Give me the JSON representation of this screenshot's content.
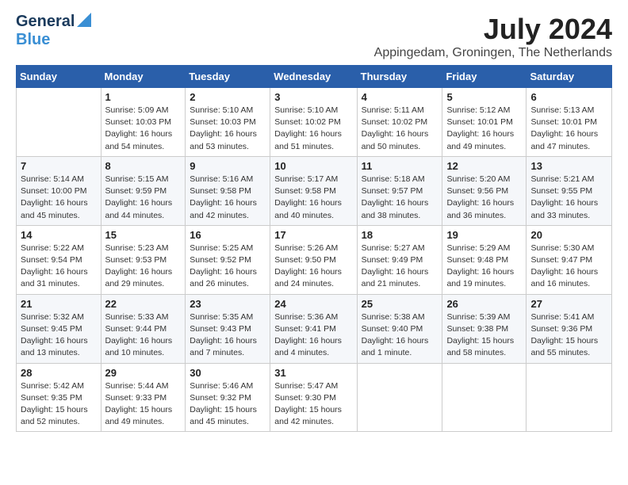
{
  "logo": {
    "general": "General",
    "blue": "Blue"
  },
  "title": {
    "month_year": "July 2024",
    "location": "Appingedam, Groningen, The Netherlands"
  },
  "headers": [
    "Sunday",
    "Monday",
    "Tuesday",
    "Wednesday",
    "Thursday",
    "Friday",
    "Saturday"
  ],
  "weeks": [
    [
      {
        "day": "",
        "info": ""
      },
      {
        "day": "1",
        "info": "Sunrise: 5:09 AM\nSunset: 10:03 PM\nDaylight: 16 hours\nand 54 minutes."
      },
      {
        "day": "2",
        "info": "Sunrise: 5:10 AM\nSunset: 10:03 PM\nDaylight: 16 hours\nand 53 minutes."
      },
      {
        "day": "3",
        "info": "Sunrise: 5:10 AM\nSunset: 10:02 PM\nDaylight: 16 hours\nand 51 minutes."
      },
      {
        "day": "4",
        "info": "Sunrise: 5:11 AM\nSunset: 10:02 PM\nDaylight: 16 hours\nand 50 minutes."
      },
      {
        "day": "5",
        "info": "Sunrise: 5:12 AM\nSunset: 10:01 PM\nDaylight: 16 hours\nand 49 minutes."
      },
      {
        "day": "6",
        "info": "Sunrise: 5:13 AM\nSunset: 10:01 PM\nDaylight: 16 hours\nand 47 minutes."
      }
    ],
    [
      {
        "day": "7",
        "info": "Sunrise: 5:14 AM\nSunset: 10:00 PM\nDaylight: 16 hours\nand 45 minutes."
      },
      {
        "day": "8",
        "info": "Sunrise: 5:15 AM\nSunset: 9:59 PM\nDaylight: 16 hours\nand 44 minutes."
      },
      {
        "day": "9",
        "info": "Sunrise: 5:16 AM\nSunset: 9:58 PM\nDaylight: 16 hours\nand 42 minutes."
      },
      {
        "day": "10",
        "info": "Sunrise: 5:17 AM\nSunset: 9:58 PM\nDaylight: 16 hours\nand 40 minutes."
      },
      {
        "day": "11",
        "info": "Sunrise: 5:18 AM\nSunset: 9:57 PM\nDaylight: 16 hours\nand 38 minutes."
      },
      {
        "day": "12",
        "info": "Sunrise: 5:20 AM\nSunset: 9:56 PM\nDaylight: 16 hours\nand 36 minutes."
      },
      {
        "day": "13",
        "info": "Sunrise: 5:21 AM\nSunset: 9:55 PM\nDaylight: 16 hours\nand 33 minutes."
      }
    ],
    [
      {
        "day": "14",
        "info": "Sunrise: 5:22 AM\nSunset: 9:54 PM\nDaylight: 16 hours\nand 31 minutes."
      },
      {
        "day": "15",
        "info": "Sunrise: 5:23 AM\nSunset: 9:53 PM\nDaylight: 16 hours\nand 29 minutes."
      },
      {
        "day": "16",
        "info": "Sunrise: 5:25 AM\nSunset: 9:52 PM\nDaylight: 16 hours\nand 26 minutes."
      },
      {
        "day": "17",
        "info": "Sunrise: 5:26 AM\nSunset: 9:50 PM\nDaylight: 16 hours\nand 24 minutes."
      },
      {
        "day": "18",
        "info": "Sunrise: 5:27 AM\nSunset: 9:49 PM\nDaylight: 16 hours\nand 21 minutes."
      },
      {
        "day": "19",
        "info": "Sunrise: 5:29 AM\nSunset: 9:48 PM\nDaylight: 16 hours\nand 19 minutes."
      },
      {
        "day": "20",
        "info": "Sunrise: 5:30 AM\nSunset: 9:47 PM\nDaylight: 16 hours\nand 16 minutes."
      }
    ],
    [
      {
        "day": "21",
        "info": "Sunrise: 5:32 AM\nSunset: 9:45 PM\nDaylight: 16 hours\nand 13 minutes."
      },
      {
        "day": "22",
        "info": "Sunrise: 5:33 AM\nSunset: 9:44 PM\nDaylight: 16 hours\nand 10 minutes."
      },
      {
        "day": "23",
        "info": "Sunrise: 5:35 AM\nSunset: 9:43 PM\nDaylight: 16 hours\nand 7 minutes."
      },
      {
        "day": "24",
        "info": "Sunrise: 5:36 AM\nSunset: 9:41 PM\nDaylight: 16 hours\nand 4 minutes."
      },
      {
        "day": "25",
        "info": "Sunrise: 5:38 AM\nSunset: 9:40 PM\nDaylight: 16 hours\nand 1 minute."
      },
      {
        "day": "26",
        "info": "Sunrise: 5:39 AM\nSunset: 9:38 PM\nDaylight: 15 hours\nand 58 minutes."
      },
      {
        "day": "27",
        "info": "Sunrise: 5:41 AM\nSunset: 9:36 PM\nDaylight: 15 hours\nand 55 minutes."
      }
    ],
    [
      {
        "day": "28",
        "info": "Sunrise: 5:42 AM\nSunset: 9:35 PM\nDaylight: 15 hours\nand 52 minutes."
      },
      {
        "day": "29",
        "info": "Sunrise: 5:44 AM\nSunset: 9:33 PM\nDaylight: 15 hours\nand 49 minutes."
      },
      {
        "day": "30",
        "info": "Sunrise: 5:46 AM\nSunset: 9:32 PM\nDaylight: 15 hours\nand 45 minutes."
      },
      {
        "day": "31",
        "info": "Sunrise: 5:47 AM\nSunset: 9:30 PM\nDaylight: 15 hours\nand 42 minutes."
      },
      {
        "day": "",
        "info": ""
      },
      {
        "day": "",
        "info": ""
      },
      {
        "day": "",
        "info": ""
      }
    ]
  ]
}
